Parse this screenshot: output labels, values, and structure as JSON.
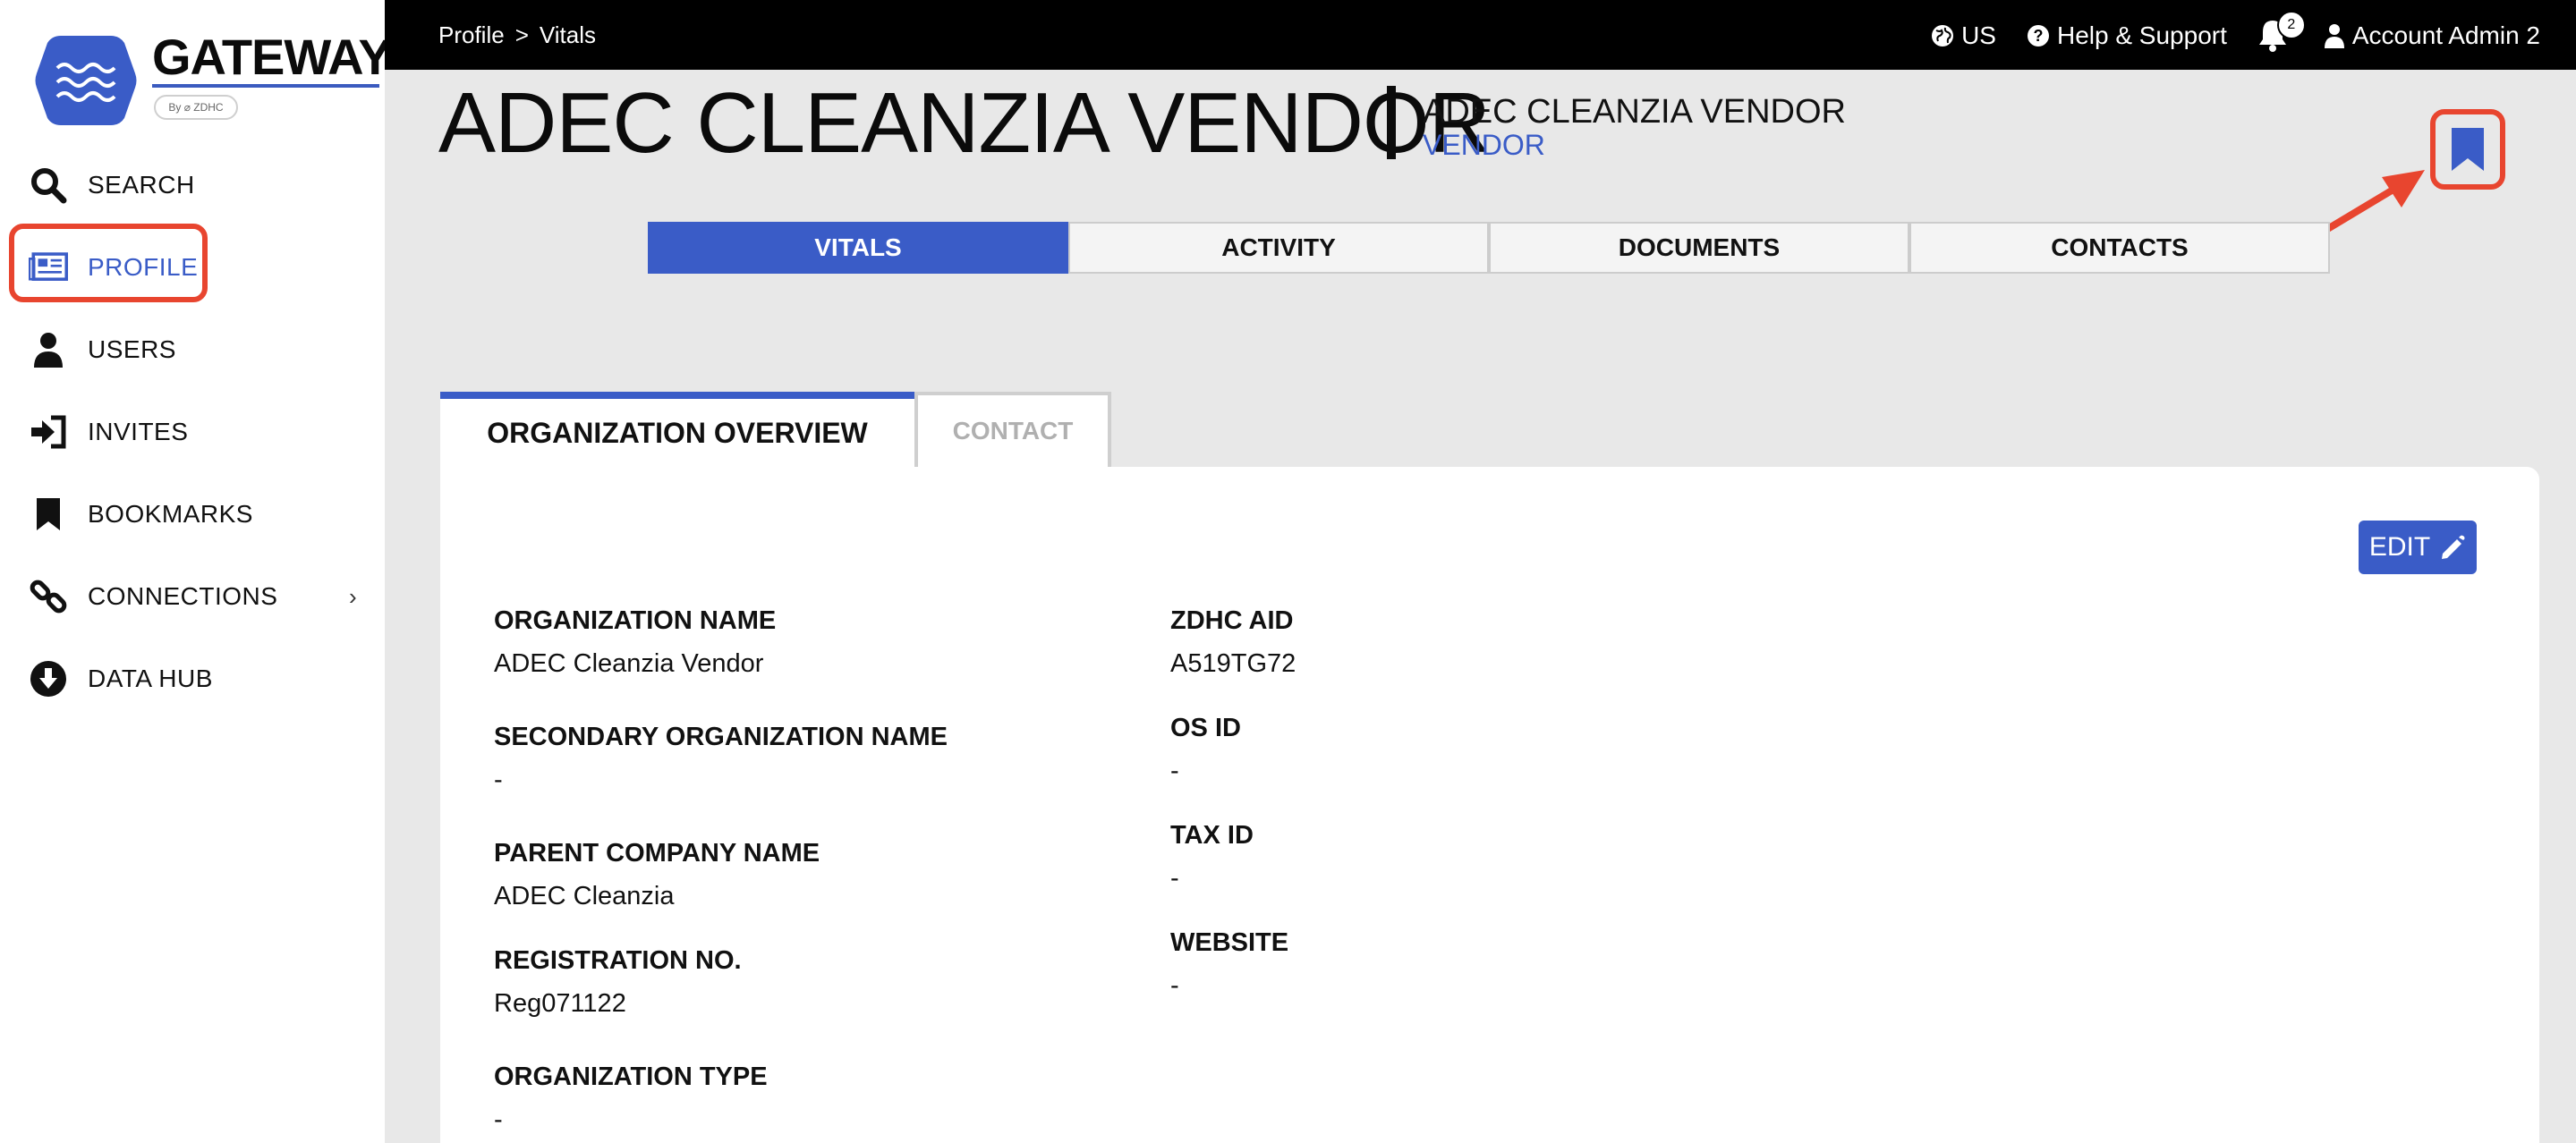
{
  "brand": {
    "name": "GATEWAY",
    "by": "By ⌀ ZDHC"
  },
  "sidebar": {
    "items": [
      {
        "label": "SEARCH",
        "icon": "search-icon"
      },
      {
        "label": "PROFILE",
        "icon": "profile-card-icon"
      },
      {
        "label": "USERS",
        "icon": "user-icon"
      },
      {
        "label": "INVITES",
        "icon": "sign-in-icon"
      },
      {
        "label": "BOOKMARKS",
        "icon": "bookmark-icon"
      },
      {
        "label": "CONNECTIONS",
        "icon": "link-icon"
      },
      {
        "label": "DATA HUB",
        "icon": "download-circle-icon"
      }
    ],
    "chevron": "›"
  },
  "topbar": {
    "breadcrumb": [
      "Profile",
      ">",
      "Vitals"
    ],
    "region": "US",
    "help": "Help & Support",
    "notifications_count": "2",
    "account": "Account Admin 2"
  },
  "header": {
    "title": "ADEC CLEANZIA VENDOR",
    "separator": "|",
    "subtitle": "ADEC CLEANZIA VENDOR",
    "type": "VENDOR"
  },
  "tabs": [
    "VITALS",
    "ACTIVITY",
    "DOCUMENTS",
    "CONTACTS"
  ],
  "subtabs": [
    "ORGANIZATION OVERVIEW",
    "CONTACT"
  ],
  "edit_label": "EDIT",
  "fields_left": [
    {
      "label": "ORGANIZATION NAME",
      "value": "ADEC Cleanzia Vendor"
    },
    {
      "label": "SECONDARY ORGANIZATION NAME",
      "value": "-"
    },
    {
      "label": "PARENT COMPANY NAME",
      "value": "ADEC Cleanzia"
    },
    {
      "label": "REGISTRATION NO.",
      "value": "Reg071122"
    },
    {
      "label": "ORGANIZATION TYPE",
      "value": "-"
    }
  ],
  "fields_right": [
    {
      "label": "ZDHC AID",
      "value": "A519TG72"
    },
    {
      "label": "OS ID",
      "value": "-"
    },
    {
      "label": "TAX ID",
      "value": "-"
    },
    {
      "label": "WEBSITE",
      "value": "-"
    }
  ],
  "colors": {
    "accent": "#3a5cc7",
    "highlight": "#e8452f",
    "topbar": "#000000"
  }
}
